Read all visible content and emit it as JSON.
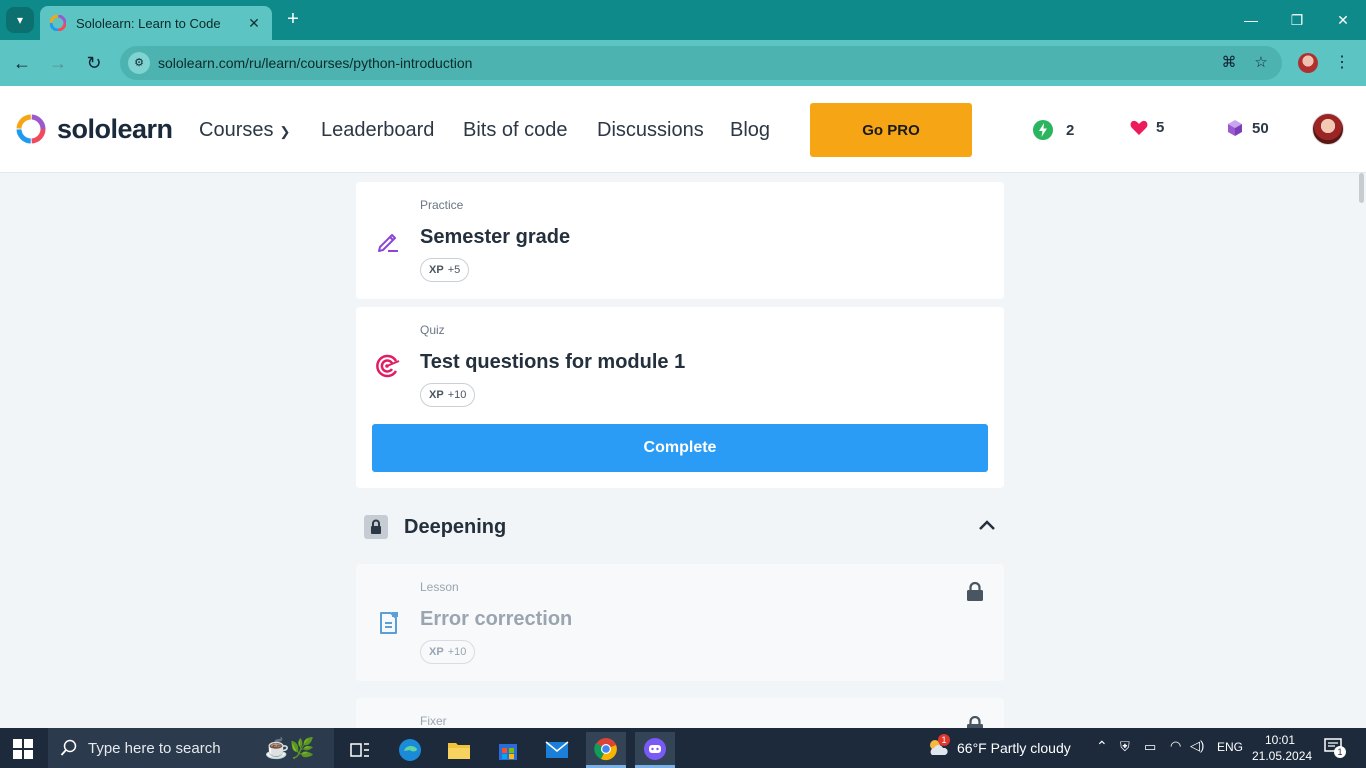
{
  "browser": {
    "tab_title": "Sololearn: Learn to Code",
    "url": "sololearn.com/ru/learn/courses/python-introduction"
  },
  "header": {
    "logo": "sololearn",
    "nav": [
      "Courses",
      "Leaderboard",
      "Bits of code",
      "Discussions",
      "Blog"
    ],
    "go_pro": "Go PRO",
    "streak": "2",
    "hearts": "5",
    "bits": "50"
  },
  "cards": [
    {
      "type": "Practice",
      "title": "Semester grade",
      "xp_label": "XP",
      "xp_value": "+5",
      "icon": "practice-pencil-icon",
      "locked": false
    },
    {
      "type": "Quiz",
      "title": "Test questions for module 1",
      "xp_label": "XP",
      "xp_value": "+10",
      "icon": "quiz-target-icon",
      "locked": false,
      "button": "Complete"
    },
    {
      "type": "Lesson",
      "title": "Error correction",
      "xp_label": "XP",
      "xp_value": "+10",
      "icon": "lesson-doc-icon",
      "locked": true
    },
    {
      "type": "Fixer",
      "locked": true
    }
  ],
  "section": {
    "title": "Deepening"
  },
  "taskbar": {
    "search_placeholder": "Type here to search",
    "weather": "66°F  Partly cloudy",
    "language": "ENG",
    "time": "10:01",
    "date": "21.05.2024",
    "notifications": "1",
    "weather_badge": "1"
  },
  "colors": {
    "accent_blue": "#2a9cf5",
    "go_pro": "#f6a614",
    "chrome_teal": "#0f8a8a"
  }
}
